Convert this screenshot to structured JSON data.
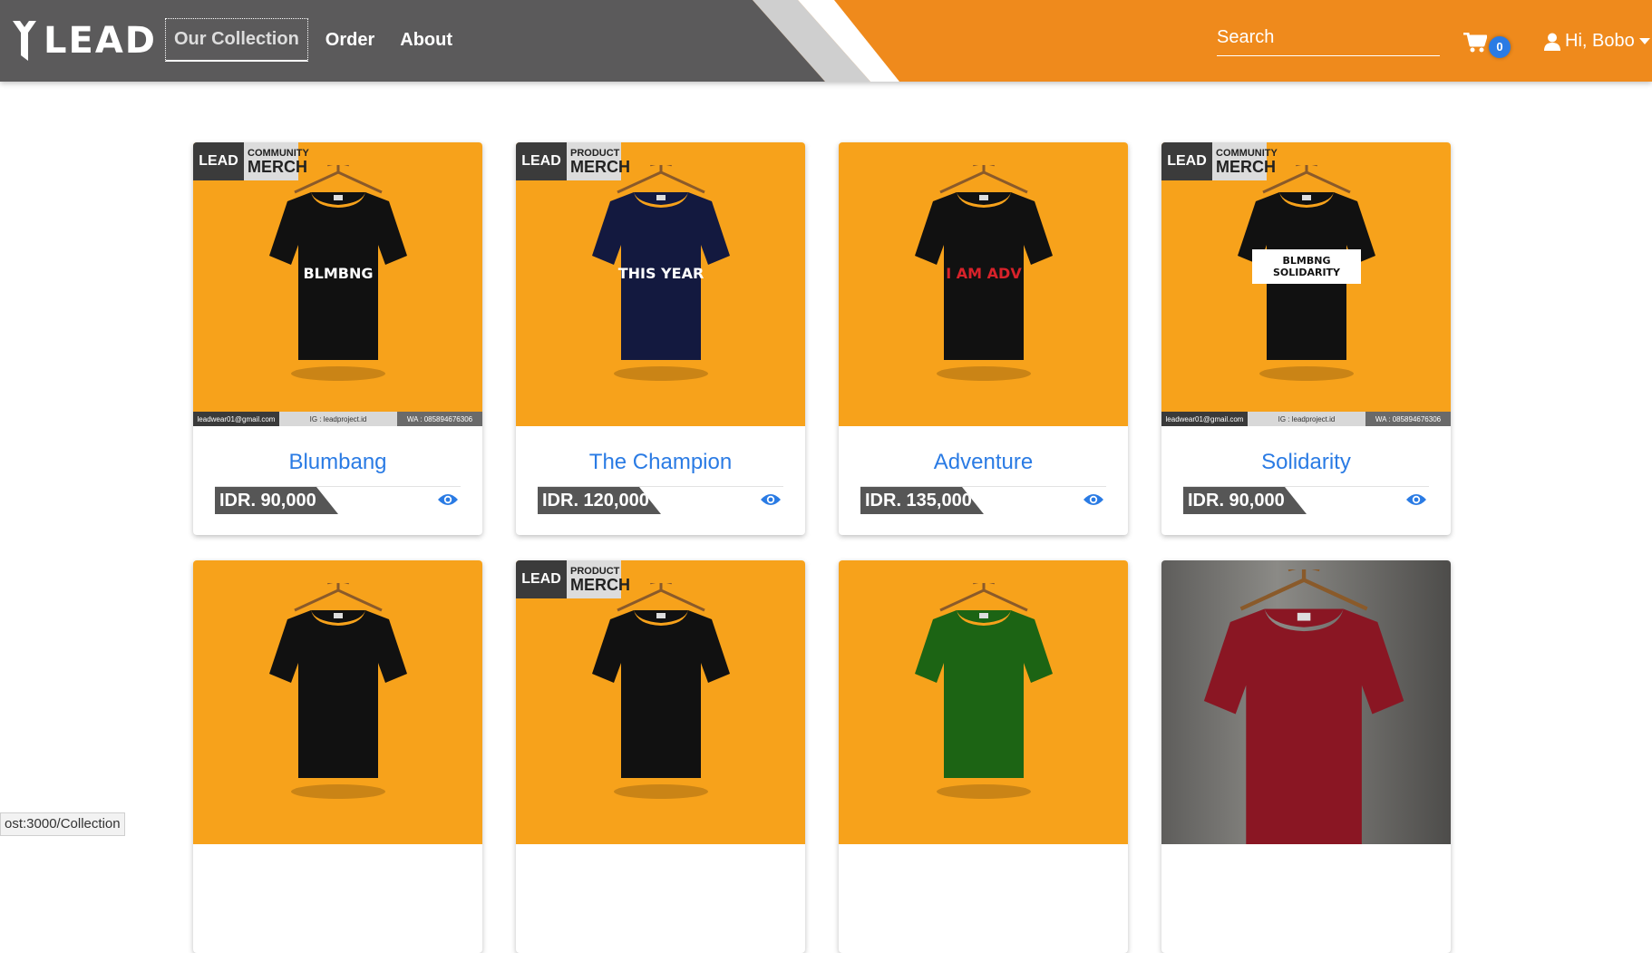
{
  "brand": {
    "logo_text": "LEAD"
  },
  "nav": {
    "links": [
      {
        "label": "Our Collection",
        "active": true
      },
      {
        "label": "Order"
      },
      {
        "label": "About"
      }
    ]
  },
  "search": {
    "placeholder": "Search",
    "value": ""
  },
  "cart": {
    "icon": "shopping-cart-icon",
    "count": "0"
  },
  "user": {
    "icon": "user-icon",
    "greeting": "Hi, Bobo",
    "caret": "chevron-down-icon"
  },
  "products": [
    {
      "title": "Blumbang",
      "price": "IDR. 90,000",
      "shirt_color": "#111111",
      "print": "BLMBNG",
      "badge": {
        "left": "LEAD",
        "top": "COMMUNITY",
        "bottom": "MERCH"
      },
      "footer": [
        "leadwear01@gmail.com",
        "IG : leadproject.id",
        "WA : 085894676306"
      ]
    },
    {
      "title": "The Champion",
      "price": "IDR. 120,000",
      "shirt_color": "#13193f",
      "print": "THIS YEAR",
      "badge": {
        "left": "LEAD",
        "top": "PRODUCT",
        "bottom": "MERCH"
      }
    },
    {
      "title": "Adventure",
      "price": "IDR. 135,000",
      "shirt_color": "#111111",
      "print": "I AM ADV"
    },
    {
      "title": "Solidarity",
      "price": "IDR. 90,000",
      "shirt_color": "#111111",
      "print": "BLMBNG SOLIDARITY",
      "badge": {
        "left": "LEAD",
        "top": "COMMUNITY",
        "bottom": "MERCH"
      },
      "footer": [
        "leadwear01@gmail.com",
        "IG : leadproject.id",
        "WA : 085894676306"
      ]
    },
    {
      "title": "",
      "price": "",
      "shirt_color": "#111111",
      "print": ""
    },
    {
      "title": "",
      "price": "",
      "shirt_color": "#111111",
      "print": "",
      "badge": {
        "left": "LEAD",
        "top": "PRODUCT",
        "bottom": "MERCH"
      }
    },
    {
      "title": "",
      "price": "",
      "shirt_color": "#1c6414",
      "print": ""
    },
    {
      "title": "",
      "price": "",
      "shirt_color": "#8a1623",
      "print": "",
      "dark_bg": true
    }
  ],
  "status_bar": {
    "url": "ost:3000/Collection"
  },
  "colors": {
    "nav_orange": "#ef8a1c",
    "nav_gray": "#5b5a5b",
    "link_blue": "#2a7be4",
    "card_orange": "#f7a21b"
  }
}
